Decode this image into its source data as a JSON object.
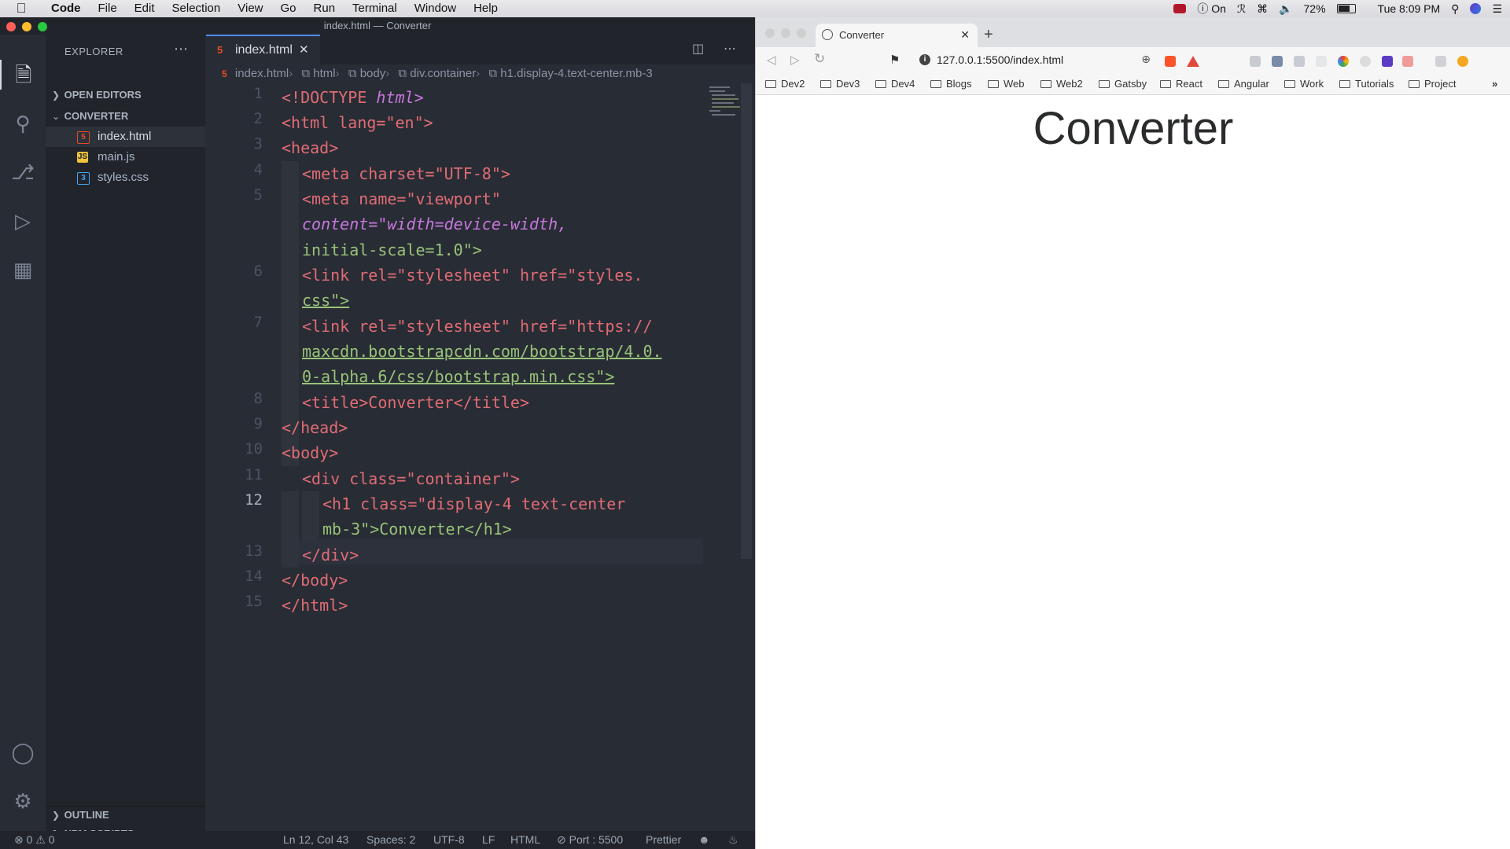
{
  "menubar": {
    "app": "Code",
    "items": [
      "File",
      "Edit",
      "Selection",
      "View",
      "Go",
      "Run",
      "Terminal",
      "Window",
      "Help"
    ],
    "status": {
      "focus": "On",
      "battery_percent": "72%",
      "clock": "Tue 8:09 PM"
    }
  },
  "vscode": {
    "window_title": "index.html — Converter",
    "explorer_title": "EXPLORER",
    "sections": {
      "open_editors": "OPEN EDITORS",
      "project": "CONVERTER",
      "outline": "OUTLINE",
      "npm_scripts": "NPM SCRIPTS"
    },
    "files": [
      {
        "name": "index.html",
        "icon": "html5-icon",
        "selected": true
      },
      {
        "name": "main.js",
        "icon": "js-icon",
        "selected": false
      },
      {
        "name": "styles.css",
        "icon": "css3-icon",
        "selected": false
      }
    ],
    "active_tab": "index.html",
    "breadcrumbs": [
      "index.html",
      "html",
      "body",
      "div.container",
      "h1.display-4.text-center.mb-3"
    ],
    "line_numbers": [
      "1",
      "2",
      "3",
      "4",
      "5",
      "6",
      "7",
      "8",
      "9",
      "10",
      "11",
      "12",
      "13",
      "14",
      "15"
    ],
    "code_lines": [
      {
        "pre": "<!",
        "tag": "DOCTYPE",
        "post": " html>"
      },
      {
        "text": "<html lang=\"en\">"
      },
      {
        "text": "<head>"
      },
      {
        "text": "<meta charset=\"UTF-8\">"
      },
      {
        "text": "<meta name=\"viewport\""
      },
      {
        "text": "content=\"width=device-width,"
      },
      {
        "text": "initial-scale=1.0\">"
      },
      {
        "text": "<link rel=\"stylesheet\" href=\"styles."
      },
      {
        "text": "css\">"
      },
      {
        "text": "<link rel=\"stylesheet\" href=\"https://"
      },
      {
        "text": "maxcdn.bootstrapcdn.com/bootstrap/4.0."
      },
      {
        "text": "0-alpha.6/css/bootstrap.min.css\">"
      },
      {
        "text": "<title>Converter</title>"
      },
      {
        "text": "</head>"
      },
      {
        "text": "<body>"
      },
      {
        "text": "<div class=\"container\">"
      },
      {
        "text": "<h1 class=\"display-4 text-center"
      },
      {
        "text": "mb-3\">Converter</h1>"
      },
      {
        "text": "</div>"
      },
      {
        "text": "</body>"
      },
      {
        "text": "</html>"
      }
    ],
    "status": {
      "errors": "0",
      "warnings": "0",
      "cursor": "Ln 12, Col 43",
      "spaces": "Spaces: 2",
      "encoding": "UTF-8",
      "eol": "LF",
      "language": "HTML",
      "live_server": "Port : 5500",
      "formatter": "Prettier"
    }
  },
  "browser": {
    "tab_title": "Converter",
    "url": "127.0.0.1:5500/index.html",
    "bookmarks": [
      "Dev2",
      "Dev3",
      "Dev4",
      "Blogs",
      "Web",
      "Web2",
      "Gatsby",
      "React",
      "Angular",
      "Work",
      "Tutorials",
      "Project"
    ],
    "bookmarks_overflow": "»",
    "page_heading": "Converter"
  },
  "colors": {
    "accent": "#528bff",
    "tag": "#e06c75",
    "attr": "#c678dd",
    "string": "#98c379"
  }
}
